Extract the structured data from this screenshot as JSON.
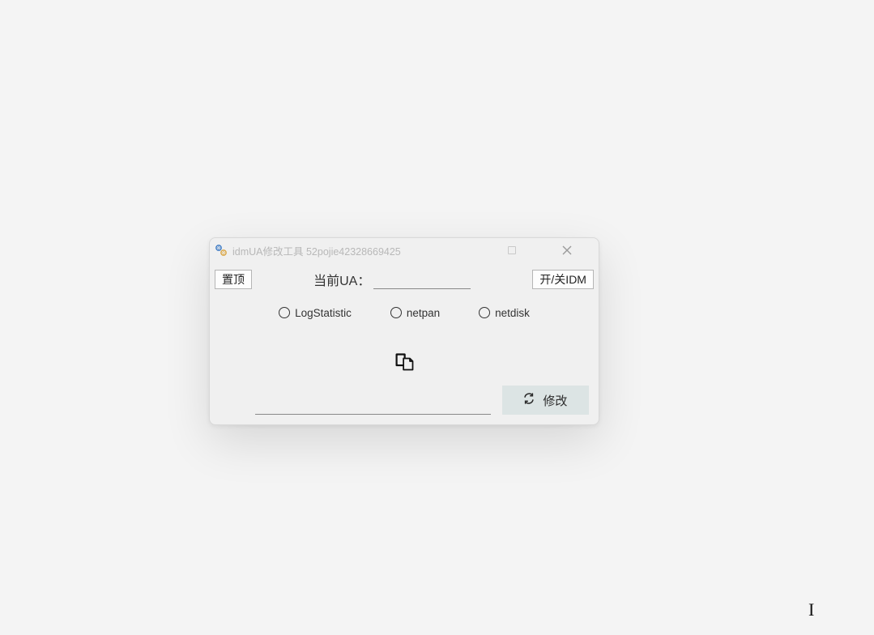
{
  "window": {
    "title": "idmUA修改工具 52pojie42328669425"
  },
  "topRow": {
    "pinButton": "置顶",
    "currentUaLabel": "当前UA：",
    "currentUaValue": "",
    "toggleIdmButton": "开/关IDM"
  },
  "radios": {
    "logStatistic": "LogStatistic",
    "netpan": "netpan",
    "netdisk": "netdisk"
  },
  "bottom": {
    "inputValue": "",
    "modifyButton": "修改"
  },
  "cursorGlyph": "I"
}
